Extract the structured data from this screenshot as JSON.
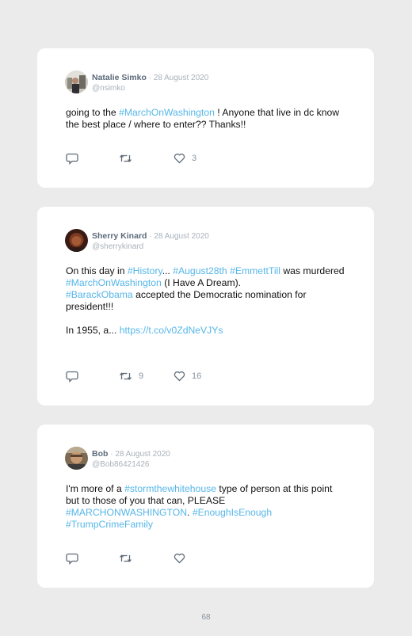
{
  "tweets": [
    {
      "author_name": "Natalie Simko",
      "separator": " · ",
      "date": "28 August 2020",
      "handle": "@nsimko",
      "text": [
        {
          "t": "going to the "
        },
        {
          "t": "#MarchOnWashington",
          "kind": "tag"
        },
        {
          "t": " ! Anyone that live in dc know the best place / where to enter?? Thanks!!"
        }
      ],
      "reply_count": "",
      "retweet_count": "",
      "like_count": "3"
    },
    {
      "author_name": "Sherry Kinard",
      "separator": " · ",
      "date": "28 August 2020",
      "handle": "@sherrykinard",
      "text": [
        {
          "t": "On this day in "
        },
        {
          "t": "#History",
          "kind": "tag"
        },
        {
          "t": "... "
        },
        {
          "t": "#August28th",
          "kind": "tag"
        },
        {
          "t": " "
        },
        {
          "t": "#EmmettTill",
          "kind": "tag"
        },
        {
          "t": " was murdered"
        },
        {
          "br": true
        },
        {
          "t": "#MarchOnWashington",
          "kind": "tag"
        },
        {
          "t": " (I Have A Dream)."
        },
        {
          "br": true
        },
        {
          "t": "#BarackObama",
          "kind": "tag"
        },
        {
          "t": " accepted the Democratic nomination for president!!!"
        },
        {
          "br": true
        },
        {
          "br": true
        },
        {
          "t": "In 1955, a... "
        },
        {
          "t": "https://t.co/v0ZdNeVJYs",
          "kind": "link"
        }
      ],
      "reply_count": "",
      "retweet_count": "9",
      "like_count": "16"
    },
    {
      "author_name": "Bob",
      "separator": " · ",
      "date": "28 August 2020",
      "handle": "@Bob86421426",
      "text": [
        {
          "t": "I'm more of a "
        },
        {
          "t": "#stormthewhitehouse",
          "kind": "tag"
        },
        {
          "t": " type of person at this point but to those of you that can, PLEASE"
        },
        {
          "br": true
        },
        {
          "t": "#MARCHONWASHINGTON",
          "kind": "tag"
        },
        {
          "t": ". "
        },
        {
          "t": "#EnoughIsEnough",
          "kind": "tag"
        },
        {
          "br": true
        },
        {
          "t": "#TrumpCrimeFamily",
          "kind": "tag"
        }
      ],
      "reply_count": "",
      "retweet_count": "",
      "like_count": ""
    }
  ],
  "icons": {
    "reply": "reply-icon",
    "retweet": "retweet-icon",
    "like": "heart-icon"
  },
  "colors": {
    "page_background": "#ebebeb",
    "card_background": "#ffffff",
    "hashtag": "#56b6e8",
    "name": "#5c6a7a",
    "muted": "#a9b1ba"
  },
  "page_number": "68"
}
